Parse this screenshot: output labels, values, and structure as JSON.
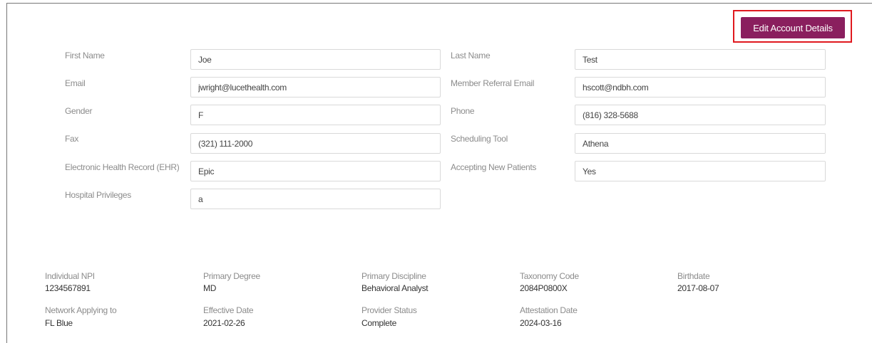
{
  "header": {
    "edit_button_label": "Edit Account Details"
  },
  "form": {
    "first_name": {
      "label": "First Name",
      "value": "Joe"
    },
    "last_name": {
      "label": "Last Name",
      "value": "Test"
    },
    "email": {
      "label": "Email",
      "value": "jwright@lucethealth.com"
    },
    "member_referral_email": {
      "label": "Member Referral Email",
      "value": "hscott@ndbh.com"
    },
    "gender": {
      "label": "Gender",
      "value": "F"
    },
    "phone": {
      "label": "Phone",
      "value": "(816) 328-5688"
    },
    "fax": {
      "label": "Fax",
      "value": "(321) 111-2000"
    },
    "scheduling_tool": {
      "label": "Scheduling Tool",
      "value": "Athena"
    },
    "ehr": {
      "label": "Electronic Health Record (EHR)",
      "value": "Epic"
    },
    "accepting_new_patients": {
      "label": "Accepting New Patients",
      "value": "Yes"
    },
    "hospital_privileges": {
      "label": "Hospital Privileges",
      "value": "a"
    }
  },
  "info": {
    "individual_npi": {
      "label": "Individual NPI",
      "value": "1234567891"
    },
    "primary_degree": {
      "label": "Primary Degree",
      "value": "MD"
    },
    "primary_discipline": {
      "label": "Primary Discipline",
      "value": "Behavioral Analyst"
    },
    "taxonomy_code": {
      "label": "Taxonomy Code",
      "value": "2084P0800X"
    },
    "birthdate": {
      "label": "Birthdate",
      "value": "2017-08-07"
    },
    "network_applying_to": {
      "label": "Network Applying to",
      "value": "FL Blue"
    },
    "effective_date": {
      "label": "Effective Date",
      "value": "2021-02-26"
    },
    "provider_status": {
      "label": "Provider Status",
      "value": "Complete"
    },
    "attestation_date": {
      "label": "Attestation Date",
      "value": "2024-03-16"
    }
  },
  "colors": {
    "button": "#8a1f5e",
    "highlight": "#e0191f"
  }
}
